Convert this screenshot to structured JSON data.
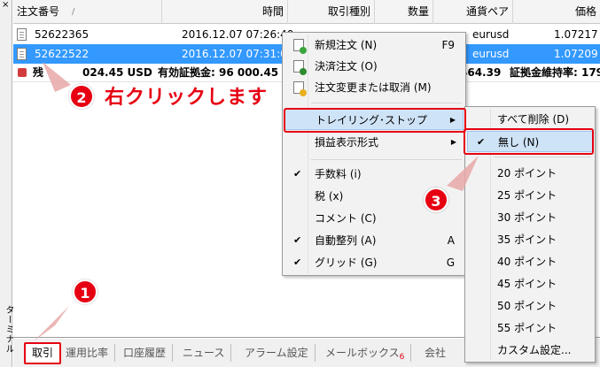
{
  "panel": {
    "close": "×",
    "vertical_label": "ターミナル"
  },
  "columns": [
    "注文番号",
    "時間",
    "取引種別",
    "数量",
    "通貨ペア",
    "価格"
  ],
  "sort_mark": "/",
  "rows": [
    {
      "order": "52622365",
      "time": "2016.12.07 07:26:40",
      "symbol": "eurusd",
      "price": "1.07217"
    },
    {
      "order": "52622522",
      "time": "2016.12.07 07:31:04",
      "symbol": "eurusd",
      "price": "1.07209"
    }
  ],
  "summary": {
    "balance_label": "残",
    "balance": "024.45 USD",
    "equity": "有効証拠金: 96 000.45",
    "margin_tail": "464.39",
    "level_label": "証拠金維持率: 179"
  },
  "context_menu": {
    "items": [
      {
        "label": "新規注文 (N)",
        "shortcut": "F9",
        "icon": "new-order-icon"
      },
      {
        "label": "決済注文 (O)",
        "shortcut": "",
        "icon": "close-order-icon"
      },
      {
        "label": "注文変更または取消 (M)",
        "shortcut": "",
        "icon": "modify-order-icon"
      },
      {
        "label": "トレイリング･ストップ",
        "shortcut": "",
        "submenu": true,
        "highlighted": true
      },
      {
        "label": "損益表示形式",
        "shortcut": "",
        "submenu": true
      },
      {
        "label": "手数料 (i)",
        "checked": true,
        "shortcut": ""
      },
      {
        "label": "税 (x)",
        "checked": false,
        "shortcut": ""
      },
      {
        "label": "コメント (C)",
        "checked": false,
        "shortcut": ""
      },
      {
        "label": "自動整列 (A)",
        "checked": true,
        "shortcut": "A"
      },
      {
        "label": "グリッド (G)",
        "checked": true,
        "shortcut": "G"
      }
    ],
    "check_glyph": "✔",
    "arrow_glyph": "▶"
  },
  "submenu": {
    "items": [
      "すべて削除 (D)",
      "無し (N)",
      "20 ポイント",
      "25 ポイント",
      "30 ポイント",
      "35 ポイント",
      "40 ポイント",
      "45 ポイント",
      "50 ポイント",
      "55 ポイント",
      "カスタム設定..."
    ],
    "checked_index": 1
  },
  "tabs": [
    {
      "label": "取引",
      "active": true
    },
    {
      "label": "運用比率"
    },
    {
      "label": "口座履歴"
    },
    {
      "label": "ニュース"
    },
    {
      "label": "アラーム設定"
    },
    {
      "label": "メールボックス",
      "badge": "6"
    },
    {
      "label": "会社"
    }
  ],
  "annotations": {
    "step1": "1",
    "step2": "2",
    "step3": "3",
    "step2_text": "右クリックします",
    "color": "#e60012"
  }
}
